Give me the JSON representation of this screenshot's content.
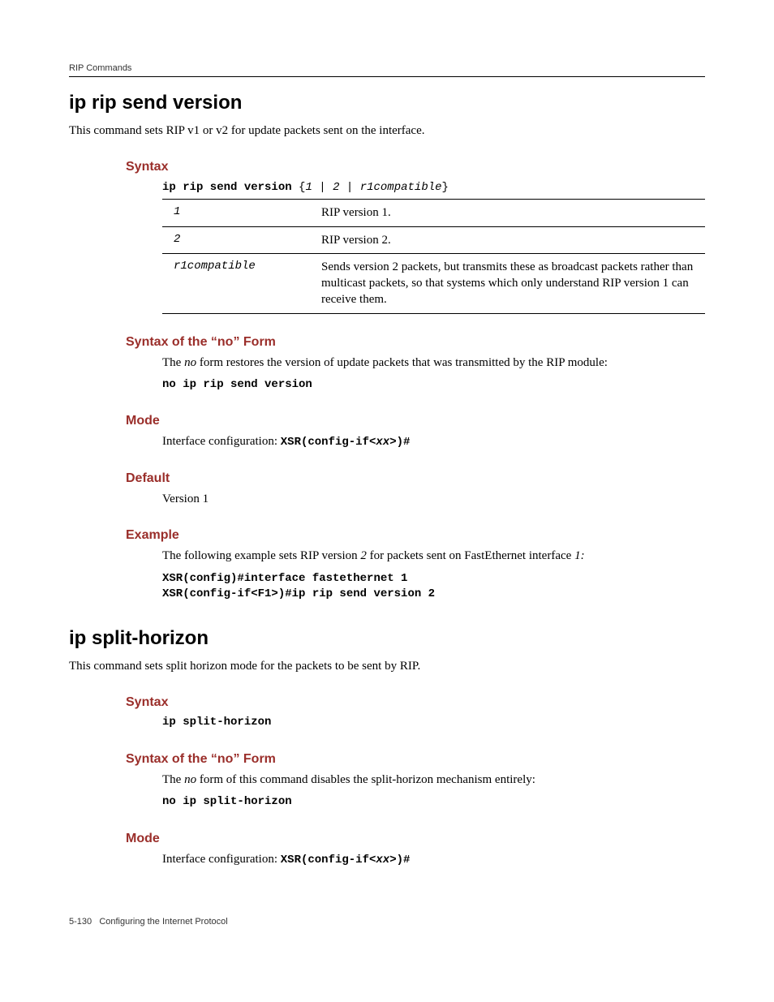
{
  "header": {
    "running_head": "RIP Commands"
  },
  "sec1": {
    "title": "ip rip send version",
    "intro": "This command sets RIP v1 or v2 for update packets sent on the interface.",
    "syntax_heading": "Syntax",
    "syntax_cmd_bold": "ip rip send version",
    "syntax_cmd_rest_open": " {",
    "syntax_opt1": "1",
    "syntax_sep1": " | ",
    "syntax_opt2": "2",
    "syntax_sep2": " | ",
    "syntax_opt3": "r1compatible",
    "syntax_cmd_rest_close": "}",
    "params": [
      {
        "key": "1",
        "desc": "RIP version 1."
      },
      {
        "key": "2",
        "desc": "RIP version 2."
      },
      {
        "key": "r1compatible",
        "desc": "Sends version 2 packets, but transmits these as broadcast packets rather than multicast packets, so that systems which only understand RIP version 1 can receive them."
      }
    ],
    "noform_heading": "Syntax of the “no” Form",
    "noform_pre": "The ",
    "noform_no": "no",
    "noform_post": " form restores the version of update packets that was transmitted by the RIP module:",
    "noform_code": "no ip rip send version",
    "mode_heading": "Mode",
    "mode_pre": "Interface configuration: ",
    "mode_code_a": "XSR(config-if<",
    "mode_code_xx": "xx",
    "mode_code_b": ">)#",
    "default_heading": "Default",
    "default_text": "Version 1",
    "example_heading": "Example",
    "example_pre": "The following example sets RIP version ",
    "example_v": "2",
    "example_mid": " for packets sent on FastEthernet interface ",
    "example_if": "1:",
    "example_code": "XSR(config)#interface fastethernet 1\nXSR(config-if<F1>)#ip rip send version 2"
  },
  "sec2": {
    "title": "ip split-horizon",
    "intro": "This command sets split horizon mode for the packets to be sent by RIP.",
    "syntax_heading": "Syntax",
    "syntax_code": "ip split-horizon",
    "noform_heading": "Syntax of the “no” Form",
    "noform_pre": "The ",
    "noform_no": "no",
    "noform_post": " form of this command disables the split-horizon mechanism entirely:",
    "noform_code": "no ip split-horizon",
    "mode_heading": "Mode",
    "mode_pre": "Interface configuration: ",
    "mode_code_a": "XSR(config-if<",
    "mode_code_xx": "xx",
    "mode_code_b": ">)#"
  },
  "footer": {
    "page": "5-130",
    "label": "Configuring the Internet Protocol"
  }
}
